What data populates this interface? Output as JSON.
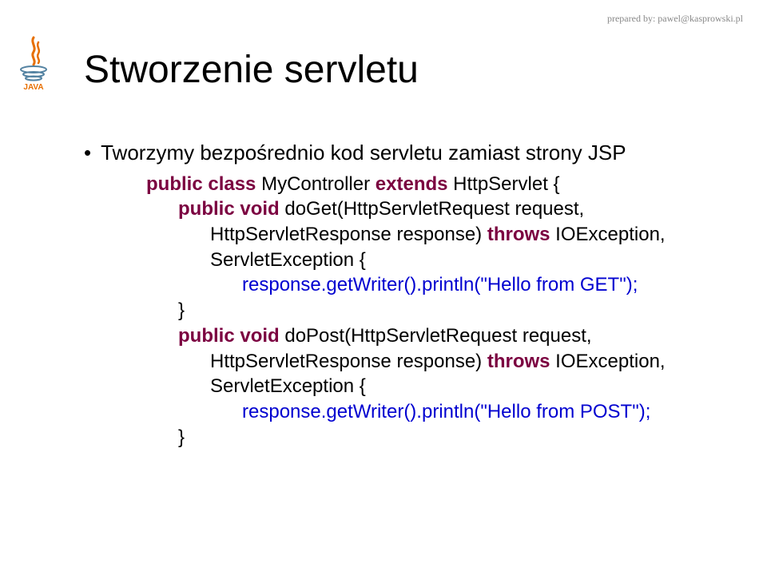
{
  "header": "prepared by: pawel@kasprowski.pl",
  "title": "Stworzenie servletu",
  "bullet": "Tworzymy bezpośrednio kod servletu zamiast strony JSP",
  "code": {
    "l1a": "public",
    "l1b": " class",
    "l1c": " MyController ",
    "l1d": "extends",
    "l1e": " HttpServlet {",
    "l2a": "public",
    "l2b": " void",
    "l2c": " doGet(HttpServletRequest request,",
    "l3": "HttpServletResponse response) ",
    "l3b": "throws",
    "l3c": " IOException,",
    "l4": "ServletException {",
    "l5": "response.getWriter().println(\"Hello from GET\");",
    "l6": "}",
    "l7a": "public",
    "l7b": " void",
    "l7c": " doPost(HttpServletRequest request,",
    "l8": "HttpServletResponse response) ",
    "l8b": "throws",
    "l8c": " IOException,",
    "l9": "ServletException {",
    "l10": "response.getWriter().println(\"Hello from POST\");",
    "l11": "}"
  }
}
